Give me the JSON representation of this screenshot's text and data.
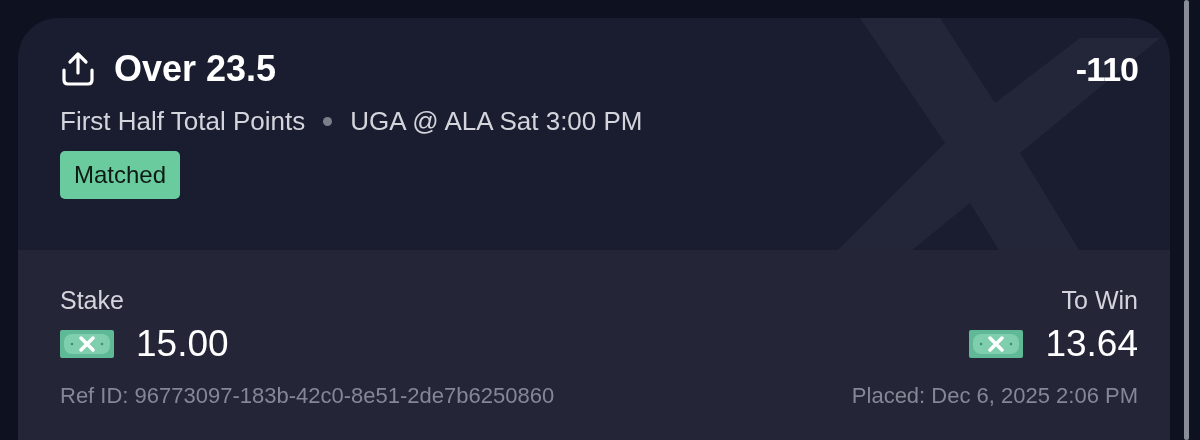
{
  "bet": {
    "title": "Over 23.5",
    "odds": "-110",
    "market": "First Half Total Points",
    "event": "UGA @ ALA Sat 3:00 PM",
    "status": {
      "label": "Matched",
      "kind": "matched"
    }
  },
  "stake": {
    "label": "Stake",
    "amount": "15.00"
  },
  "to_win": {
    "label": "To Win",
    "amount": "13.64"
  },
  "ref_id": "Ref ID: 96773097-183b-42c0-8e51-2de7b6250860",
  "placed": "Placed: Dec 6, 2025 2:06 PM"
}
